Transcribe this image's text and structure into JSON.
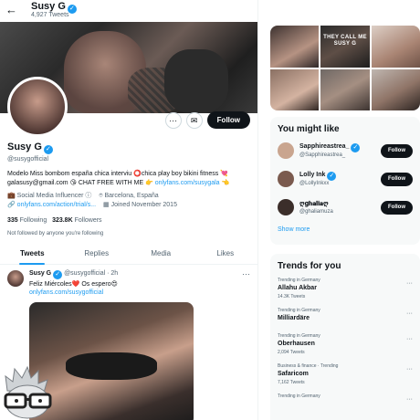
{
  "header": {
    "back_icon": "arrow-left-icon",
    "name": "Susy G",
    "tweet_count": "4,927 Tweets"
  },
  "actions": {
    "more_icon": "more-icon",
    "message_icon": "mail-icon",
    "follow_label": "Follow"
  },
  "profile": {
    "name": "Susy G",
    "handle": "@susygofficial",
    "bio_line1": "Modelo Miss bombom españa chica interviu ⭕chica play boy bikini fitness 💘",
    "bio_line2_text": "galasusy@gmail.com 😘 CHAT FREE WITH ME 👉 ",
    "bio_line2_link": "onlyfans.com/susygala",
    "bio_line2_end": " 👈",
    "category": "Social Media Influencer",
    "location": "Barcelona, España",
    "website": "onlyfans.com/action/trial/s...",
    "joined": "Joined November 2015",
    "following_count": "335",
    "following_label": "Following",
    "followers_count": "323.8K",
    "followers_label": "Followers",
    "not_followed": "Not followed by anyone you're following"
  },
  "tabs": [
    {
      "label": "Tweets",
      "active": true
    },
    {
      "label": "Replies",
      "active": false
    },
    {
      "label": "Media",
      "active": false
    },
    {
      "label": "Likes",
      "active": false
    }
  ],
  "tweet": {
    "name": "Susy G",
    "handle": "@susygofficial",
    "time": "· 2h",
    "text": "Feliz Miércoles❤️ Os espero😍",
    "link": "onlyfans.com/susygofficial"
  },
  "media_grid": {
    "overlay_line1": "THEY CALL ME",
    "overlay_line2": "SUSY G"
  },
  "might_like": {
    "title": "You might like",
    "users": [
      {
        "name": "Sapphireastrea_",
        "handle": "@Sapphireastrea_",
        "verified": true,
        "follow": "Follow",
        "color": "#c9a58f"
      },
      {
        "name": "Lolly Ink",
        "handle": "@LollyInkxx",
        "verified": true,
        "follow": "Follow",
        "color": "#7a5a4e"
      },
      {
        "name": "ღ𝐠𝐡𝐚𝐥𝐢𝐚ღ",
        "handle": "@ghaliamuza",
        "verified": false,
        "follow": "Follow",
        "color": "#3b2e2a"
      }
    ],
    "show_more": "Show more"
  },
  "trends": {
    "title": "Trends for you",
    "items": [
      {
        "context": "Trending in Germany",
        "topic": "Allahu Akbar",
        "count": "14.3K Tweets"
      },
      {
        "context": "Trending in Germany",
        "topic": "Milliardäre",
        "count": ""
      },
      {
        "context": "Trending in Germany",
        "topic": "Oberhausen",
        "count": "2,094 Tweets"
      },
      {
        "context": "Business & finance · Trending",
        "topic": "Safaricom",
        "count": "7,162 Tweets"
      },
      {
        "context": "Trending in Germany",
        "topic": "",
        "count": ""
      }
    ]
  },
  "colors": {
    "accent": "#1d9bf0",
    "text": "#0f1419",
    "muted": "#536471"
  }
}
